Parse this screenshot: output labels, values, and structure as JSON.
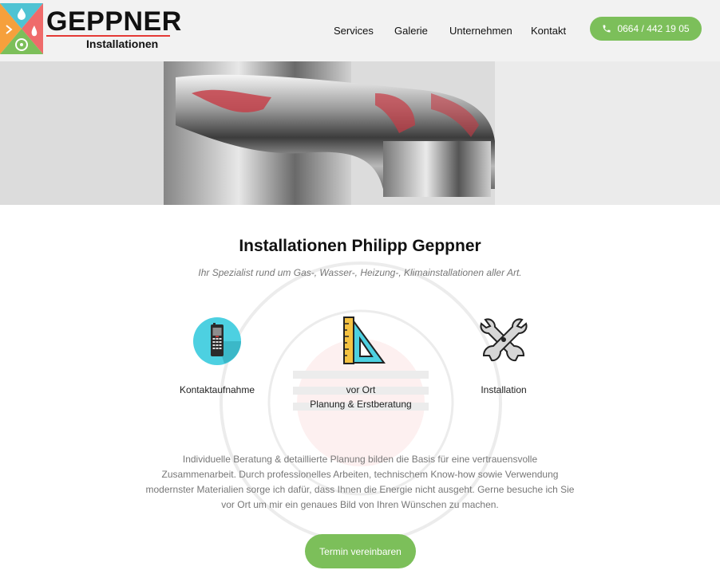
{
  "brand": {
    "name": "GEPPNER",
    "tagline": "Installationen"
  },
  "nav": {
    "services": "Services",
    "galerie": "Galerie",
    "unternehmen": "Unternehmen",
    "kontakt": "Kontakt"
  },
  "phone": {
    "number": "0664 / 442 19 05",
    "icon": "phone-icon"
  },
  "hero": {
    "image": "faucet-photo"
  },
  "main": {
    "title": "Installationen Philipp Geppner",
    "subtitle": "Ihr Spezialist rund um Gas-, Wasser-, Heizung-, Klimainstallationen aller Art.",
    "features": [
      {
        "icon": "mobile-phone-icon",
        "label": "Kontaktaufnahme"
      },
      {
        "icon": "ruler-triangle-icon",
        "label_line1": "vor Ort",
        "label_line2": "Planung & Erstberatung"
      },
      {
        "icon": "wrench-tools-icon",
        "label": "Installation"
      }
    ],
    "body_lines": [
      "Individuelle Beratung & detaillierte Planung bilden die Basis für eine vertrauensvolle",
      "Zusammenarbeit. Durch professionelles Arbeiten, technischem Know-how sowie Verwendung",
      "modernster Materialien sorge ich dafür, dass Ihnen die Energie nicht ausgeht. Gerne besuche ich Sie",
      "vor Ort um mir ein genaues Bild von Ihren Wünschen zu machen."
    ],
    "cta": "Termin vereinbaren"
  },
  "colors": {
    "accent_green": "#7cbf5a",
    "header_bg": "#f2f2f2",
    "brand_red": "#e53935",
    "icon_cyan": "#4dd0e1"
  }
}
